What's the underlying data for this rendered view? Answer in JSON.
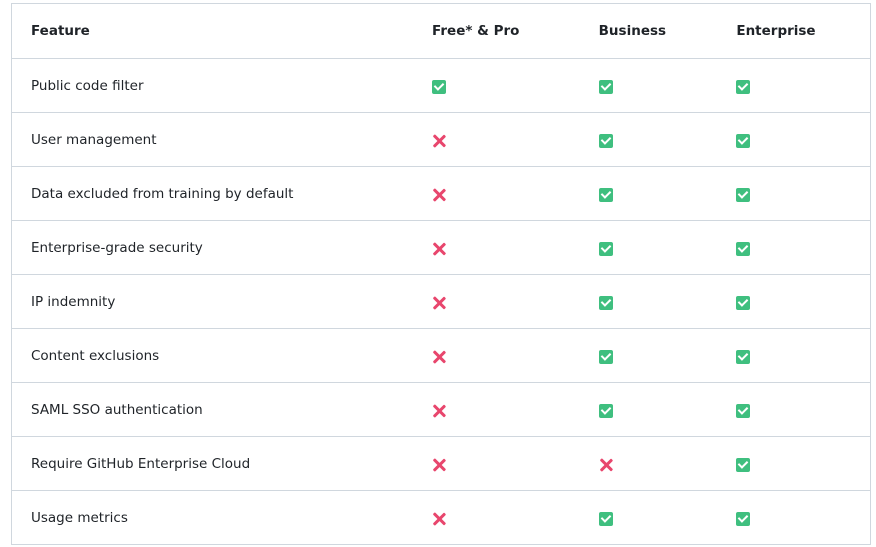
{
  "table": {
    "headers": {
      "feature": "Feature",
      "free_pro": "Free* & Pro",
      "business": "Business",
      "enterprise": "Enterprise"
    },
    "rows": [
      {
        "feature": "Public code filter",
        "free_pro": "check",
        "business": "check",
        "enterprise": "check"
      },
      {
        "feature": "User management",
        "free_pro": "cross",
        "business": "check",
        "enterprise": "check"
      },
      {
        "feature": "Data excluded from training by default",
        "free_pro": "cross",
        "business": "check",
        "enterprise": "check"
      },
      {
        "feature": "Enterprise-grade security",
        "free_pro": "cross",
        "business": "check",
        "enterprise": "check"
      },
      {
        "feature": "IP indemnity",
        "free_pro": "cross",
        "business": "check",
        "enterprise": "check"
      },
      {
        "feature": "Content exclusions",
        "free_pro": "cross",
        "business": "check",
        "enterprise": "check"
      },
      {
        "feature": "SAML SSO authentication",
        "free_pro": "cross",
        "business": "check",
        "enterprise": "check"
      },
      {
        "feature": "Require GitHub Enterprise Cloud",
        "free_pro": "cross",
        "business": "cross",
        "enterprise": "check"
      },
      {
        "feature": "Usage metrics",
        "free_pro": "cross",
        "business": "check",
        "enterprise": "check"
      }
    ]
  },
  "icons": {
    "check": "check-mark-icon",
    "cross": "cross-mark-icon"
  },
  "colors": {
    "check": "#3fbf7f",
    "cross": "#e8466d",
    "border": "#d0d7de",
    "text": "#1f2328"
  }
}
